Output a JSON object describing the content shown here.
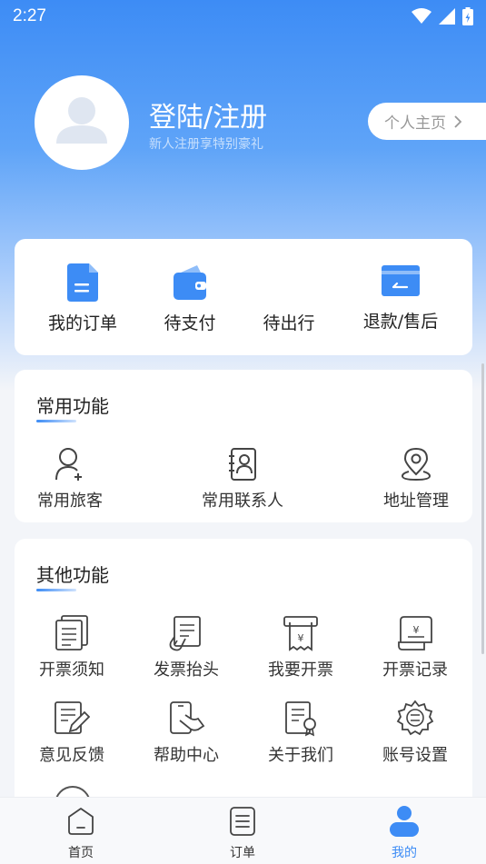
{
  "status_bar": {
    "time": "2:27"
  },
  "profile": {
    "login_title": "登陆/注册",
    "login_subtitle": "新人注册享特别豪礼",
    "profile_link": "个人主页"
  },
  "orders": [
    {
      "label": "我的订单",
      "icon": "document-icon"
    },
    {
      "label": "待支付",
      "icon": "wallet-icon"
    },
    {
      "label": "待出行",
      "icon": ""
    },
    {
      "label": "退款/售后",
      "icon": "card-refund-icon"
    }
  ],
  "common_functions": {
    "title": "常用功能",
    "items": [
      {
        "label": "常用旅客",
        "icon": "passenger-icon"
      },
      {
        "label": "常用联系人",
        "icon": "contact-book-icon"
      },
      {
        "label": "地址管理",
        "icon": "location-pin-icon"
      }
    ]
  },
  "other_functions": {
    "title": "其他功能",
    "items": [
      {
        "label": "开票须知",
        "icon": "invoice-notice-icon"
      },
      {
        "label": "发票抬头",
        "icon": "invoice-title-icon"
      },
      {
        "label": "我要开票",
        "icon": "issue-invoice-icon"
      },
      {
        "label": "开票记录",
        "icon": "invoice-record-icon"
      },
      {
        "label": "意见反馈",
        "icon": "feedback-icon"
      },
      {
        "label": "帮助中心",
        "icon": "help-center-icon"
      },
      {
        "label": "关于我们",
        "icon": "about-us-icon"
      },
      {
        "label": "账号设置",
        "icon": "settings-gear-icon"
      }
    ]
  },
  "tabbar": [
    {
      "label": "首页",
      "icon": "home-icon",
      "active": false
    },
    {
      "label": "订单",
      "icon": "orders-list-icon",
      "active": false
    },
    {
      "label": "我的",
      "icon": "user-profile-icon",
      "active": true
    }
  ],
  "colors": {
    "accent": "#3d8cf5",
    "background": "#f3f5f9"
  }
}
